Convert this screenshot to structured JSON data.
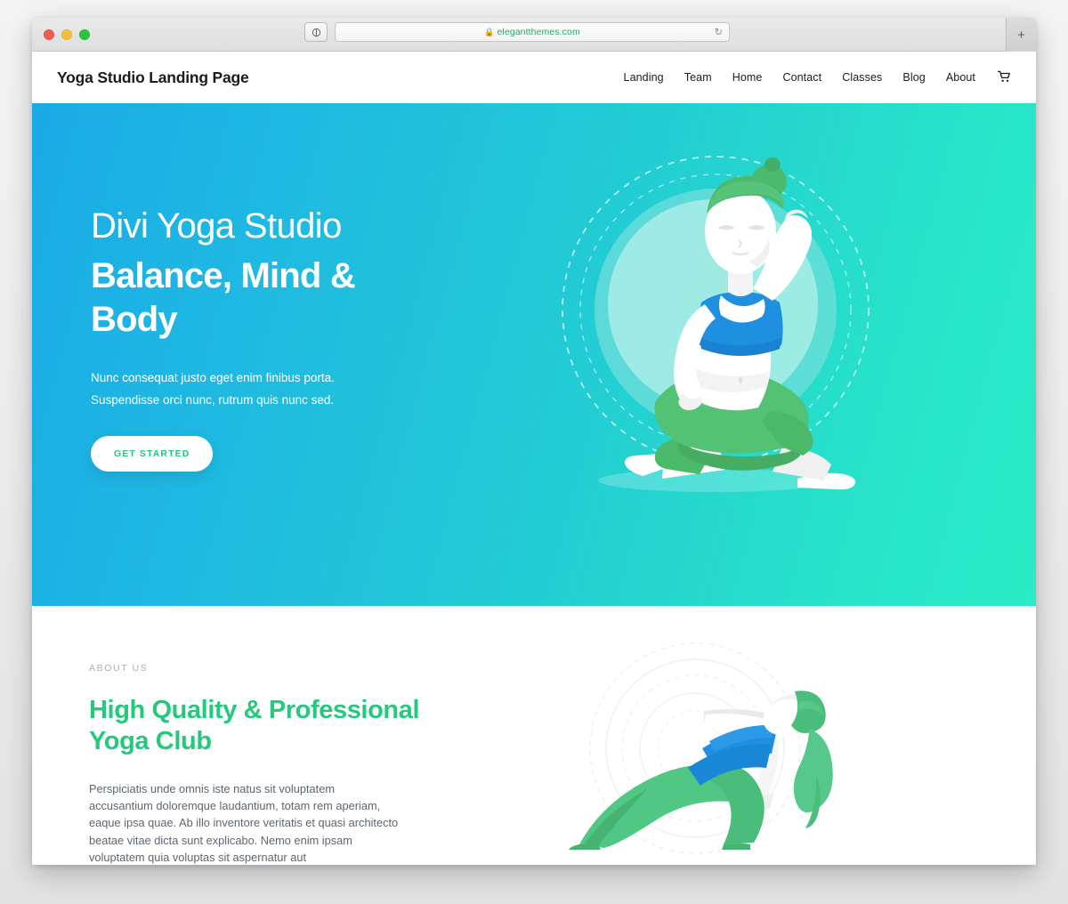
{
  "browser": {
    "traffic_lights": [
      "close",
      "minimize",
      "zoom"
    ],
    "shield_icon": "shield-icon",
    "url": "elegantthemes.com",
    "lock_icon": "lock-icon",
    "reload_icon": "reload-icon",
    "newtab_label": "+"
  },
  "site": {
    "brand": "Yoga Studio Landing Page",
    "menu": [
      {
        "label": "Landing"
      },
      {
        "label": "Team"
      },
      {
        "label": "Home"
      },
      {
        "label": "Contact"
      },
      {
        "label": "Classes"
      },
      {
        "label": "Blog"
      },
      {
        "label": "About"
      }
    ],
    "cart_icon": "shopping-cart-icon"
  },
  "hero": {
    "title_light": "Divi Yoga Studio",
    "title_bold": "Balance, Mind & Body",
    "subtitle": "Nunc consequat justo eget enim finibus porta. Suspendisse orci nunc, rutrum quis nunc sed.",
    "cta_label": "GET STARTED",
    "illustration": "woman-seated-lotus-pose-illustration",
    "gradient_start": "#1aaae6",
    "gradient_end": "#2aebc6"
  },
  "about": {
    "eyebrow": "ABOUT US",
    "title": "High Quality & Professional Yoga Club",
    "body": "Perspiciatis unde omnis iste natus sit voluptatem accusantium doloremque laudantium, totam rem aperiam, eaque ipsa quae. Ab illo inventore veritatis et quasi architecto beatae vitae dicta sunt explicabo. Nemo enim ipsam voluptatem quia voluptas sit aspernatur aut",
    "illustration": "woman-side-plank-pose-illustration",
    "accent_color": "#25c97d"
  }
}
